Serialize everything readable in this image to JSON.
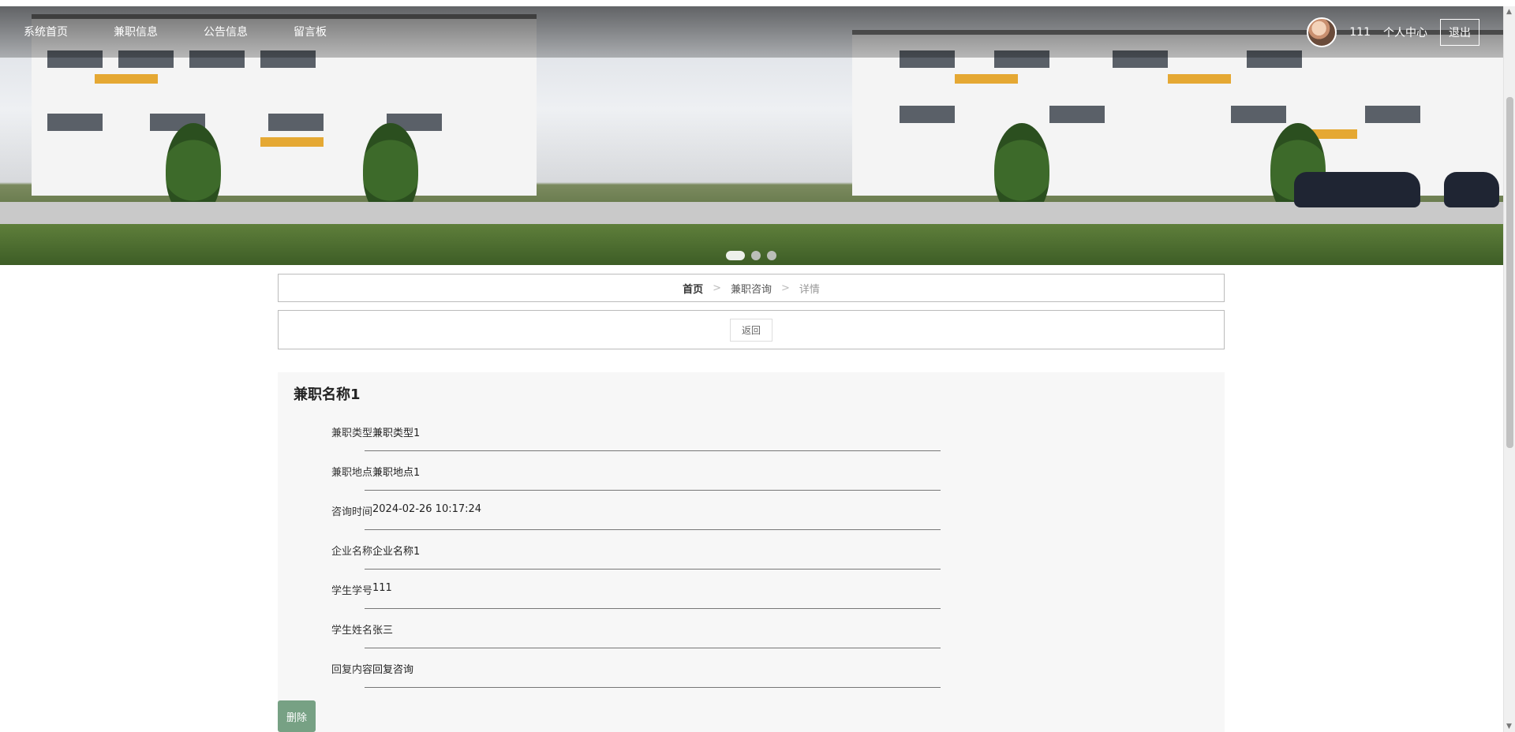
{
  "nav": {
    "items": [
      {
        "label": "系统首页"
      },
      {
        "label": "兼职信息"
      },
      {
        "label": "公告信息"
      },
      {
        "label": "留言板"
      }
    ]
  },
  "user": {
    "name": "111",
    "profile_label": "个人中心",
    "logout_label": "退出"
  },
  "carousel": {
    "active_index": 0,
    "slide_count": 3
  },
  "breadcrumb": {
    "home": "首页",
    "section": "兼职咨询",
    "current": "详情",
    "separator": ">"
  },
  "back_label": "返回",
  "detail": {
    "title": "兼职名称1",
    "fields": [
      {
        "label": "兼职类型",
        "value": "兼职类型1"
      },
      {
        "label": "兼职地点",
        "value": "兼职地点1"
      },
      {
        "label": "咨询时间",
        "value": "2024-02-26 10:17:24"
      },
      {
        "label": "企业名称",
        "value": "企业名称1"
      },
      {
        "label": "学生学号",
        "value": "111"
      },
      {
        "label": "学生姓名",
        "value": "张三"
      },
      {
        "label": "回复内容",
        "value": "回复咨询"
      }
    ],
    "delete_label": "删除"
  },
  "colors": {
    "delete_button": "#77a184",
    "panel_background": "#f7f7f7"
  }
}
